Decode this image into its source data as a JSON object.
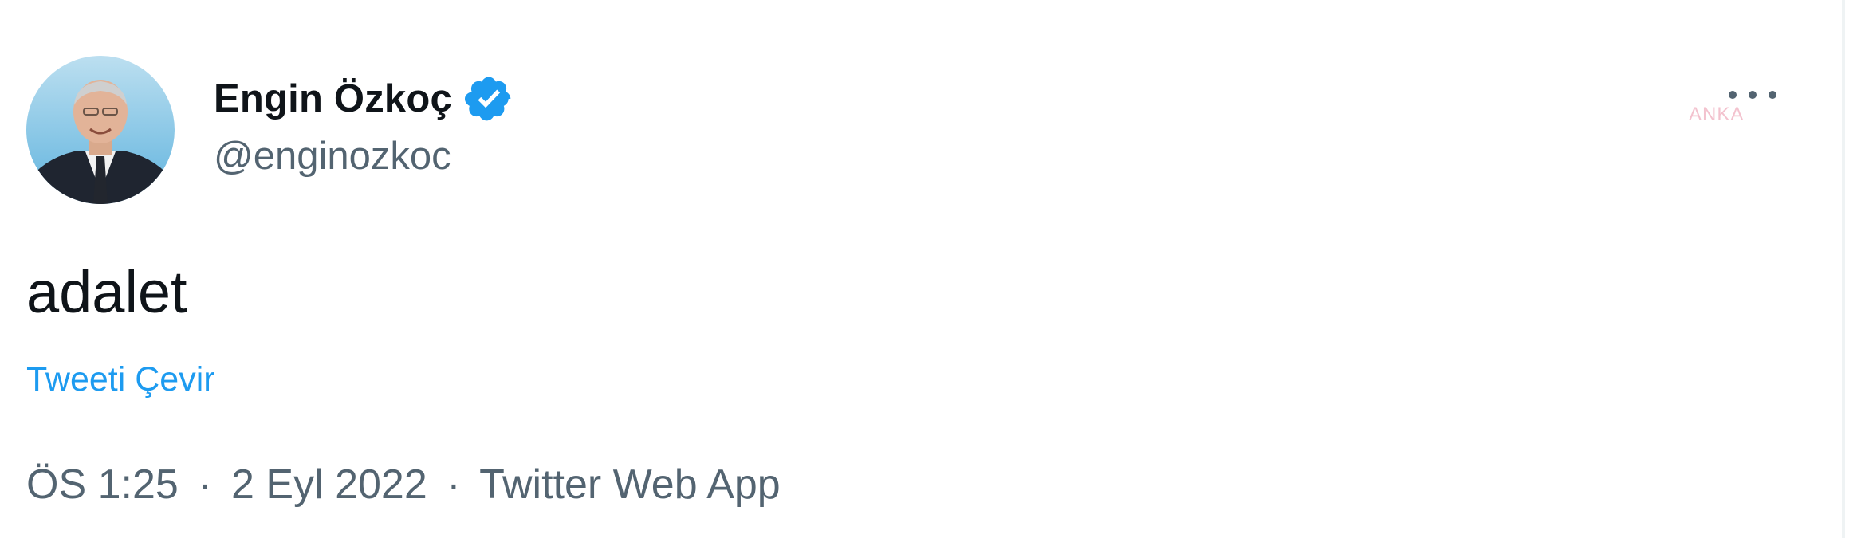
{
  "author": {
    "display_name": "Engin Özkoç",
    "handle": "@enginozkoc",
    "verified": true,
    "avatar_icon": "avatar-photo"
  },
  "tweet": {
    "text": "adalet",
    "translate_label": "Tweeti Çevir"
  },
  "meta": {
    "time": "ÖS 1:25",
    "separator": "·",
    "date": "2 Eyl 2022",
    "source": "Twitter Web App"
  },
  "watermark": "ANKA",
  "colors": {
    "link": "#1d9bf0",
    "verified": "#1d9bf0",
    "text": "#0f1419",
    "muted": "#536471"
  }
}
